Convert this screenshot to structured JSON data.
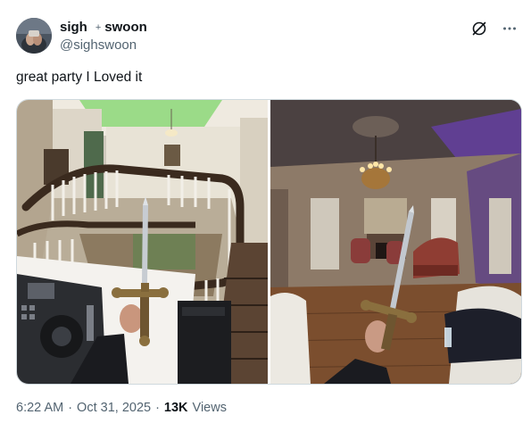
{
  "author": {
    "name": "sigh",
    "separator": "+",
    "name_suffix": "swoon",
    "handle": "@sighswoon"
  },
  "icons": {
    "mute": "slashed-circle-icon",
    "more": "more-horizontal-icon"
  },
  "post": {
    "text": "great party I Loved it"
  },
  "media": {
    "images": [
      {
        "name": "staircase-party-photo",
        "description": ""
      },
      {
        "name": "ballroom-party-photo",
        "description": ""
      }
    ]
  },
  "meta": {
    "time": "6:22 AM",
    "dot1": "·",
    "date": "Oct 31, 2025",
    "dot2": "·",
    "views_count": "13K",
    "views_label": "Views"
  },
  "colors": {
    "text": "#0f1419",
    "secondary": "#536471",
    "border": "#cfd9de"
  }
}
